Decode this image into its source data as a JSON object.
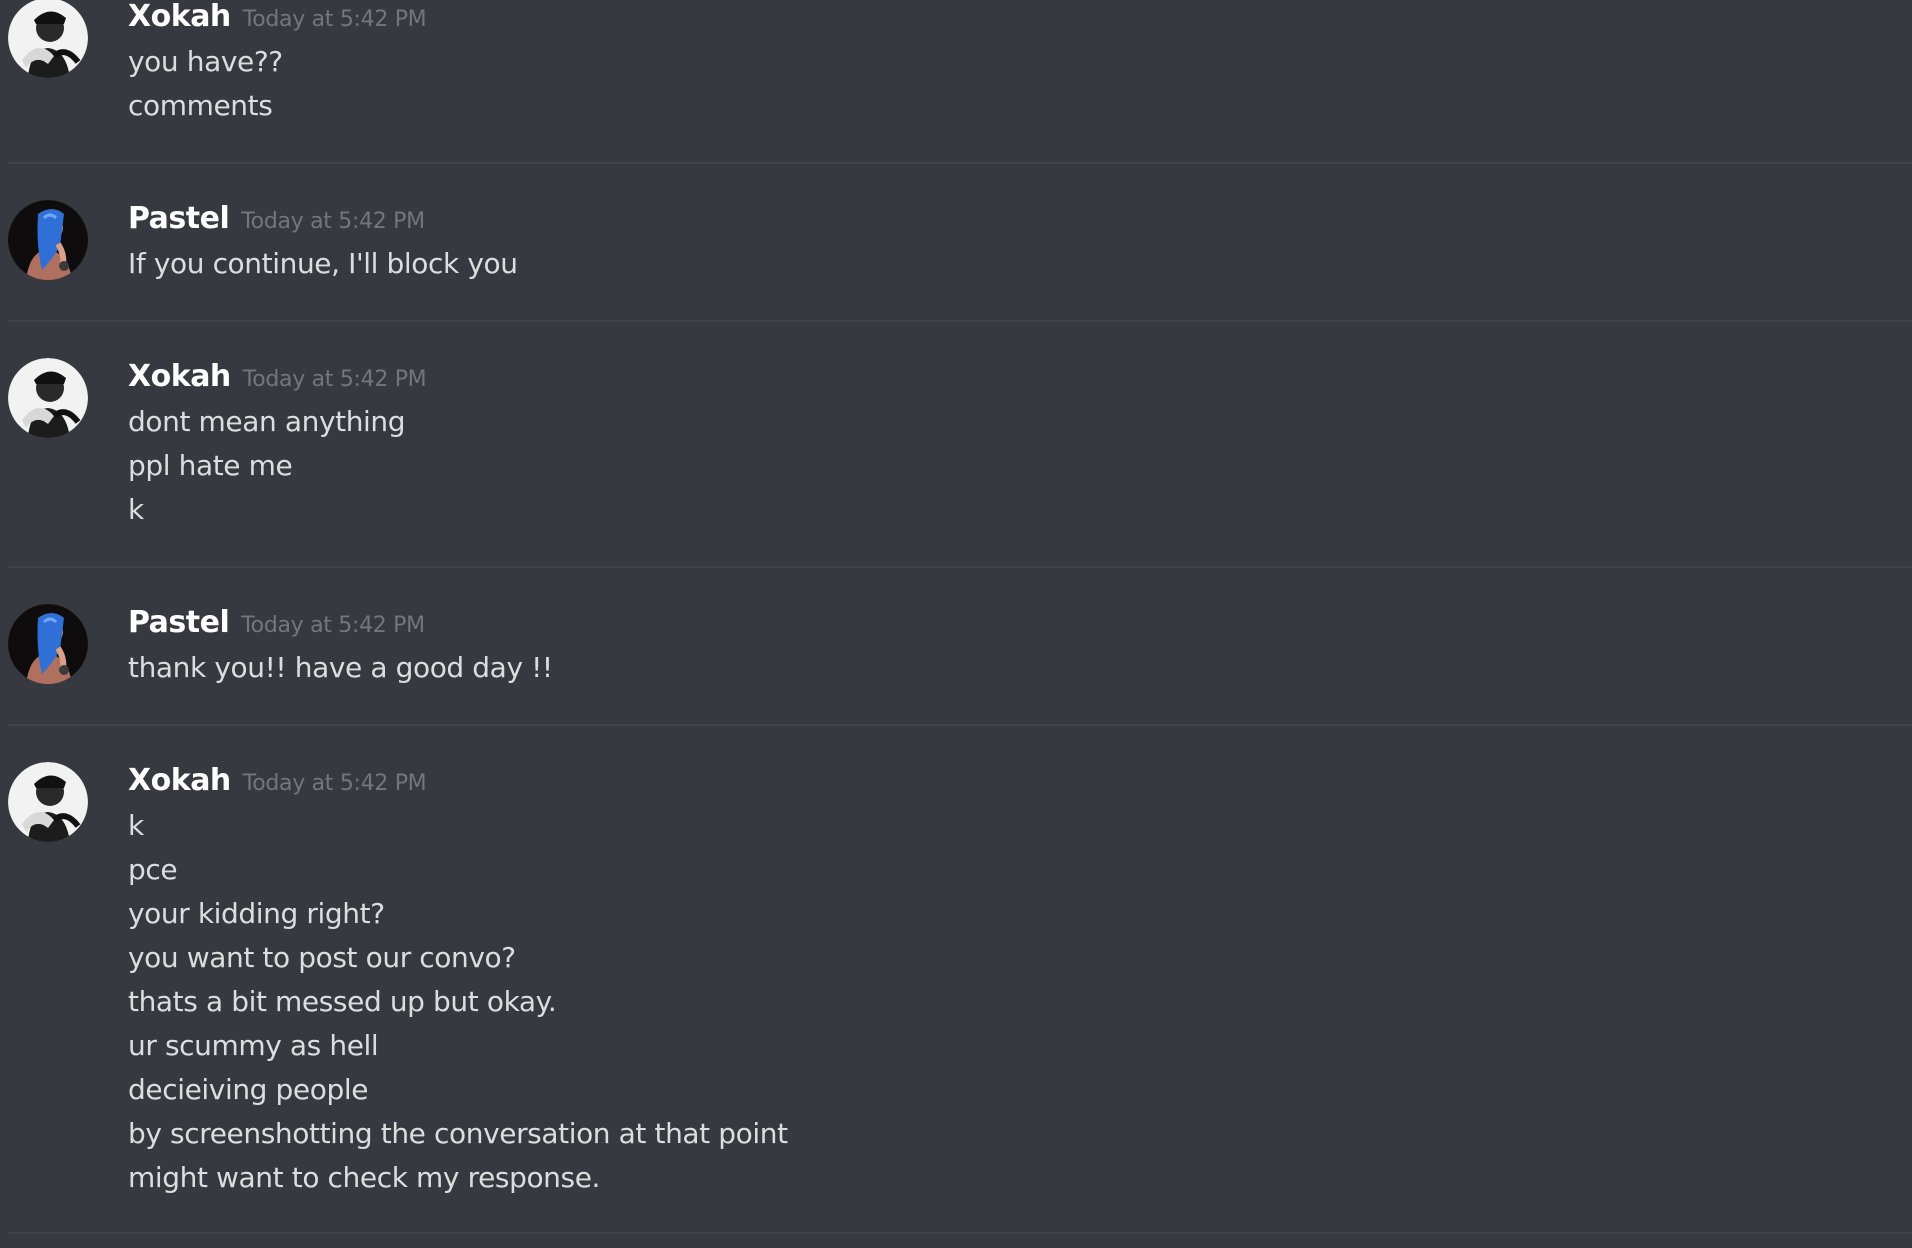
{
  "messages": [
    {
      "author": "Xokah",
      "avatar_icon": "user-avatar-black-white-icon",
      "timestamp": "Today at 5:42 PM",
      "lines": [
        "you have??",
        "comments"
      ]
    },
    {
      "author": "Pastel",
      "avatar_icon": "user-avatar-blue-hair-icon",
      "timestamp": "Today at 5:42 PM",
      "lines": [
        "If you continue, I'll block you"
      ]
    },
    {
      "author": "Xokah",
      "avatar_icon": "user-avatar-black-white-icon",
      "timestamp": "Today at 5:42 PM",
      "lines": [
        "dont mean anything",
        "ppl hate me",
        "k"
      ]
    },
    {
      "author": "Pastel",
      "avatar_icon": "user-avatar-blue-hair-icon",
      "timestamp": "Today at 5:42 PM",
      "lines": [
        "thank you!! have a good day !!"
      ]
    },
    {
      "author": "Xokah",
      "avatar_icon": "user-avatar-black-white-icon",
      "timestamp": "Today at 5:42 PM",
      "lines": [
        "k",
        "pce",
        "your kidding right?",
        "you want to post our convo?",
        "thats a bit messed up but okay.",
        "ur scummy as hell",
        "decieiving people",
        "by screenshotting the conversation at that point",
        "might want to check my response."
      ]
    }
  ],
  "colors": {
    "background": "#36393f",
    "username": "#ffffff",
    "timestamp": "#72767d",
    "message_text": "#dcddde",
    "divider": "#3f4248"
  }
}
